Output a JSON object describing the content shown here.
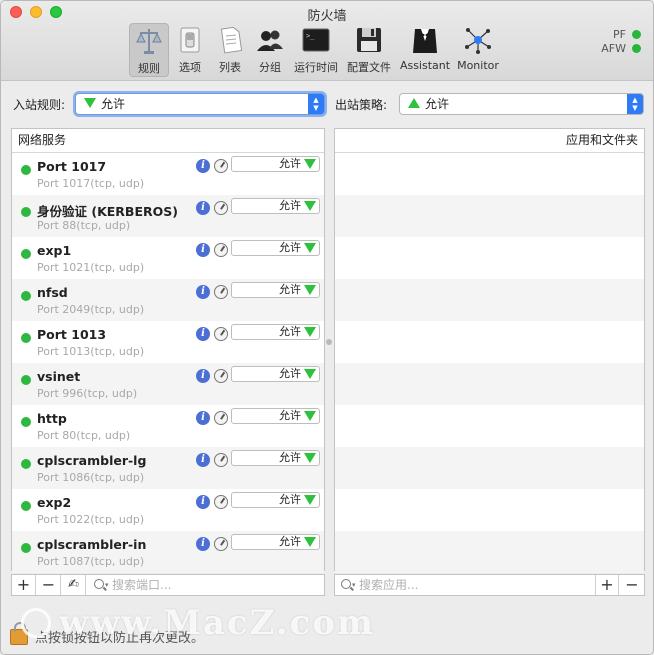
{
  "window": {
    "title": "防火墙"
  },
  "toolbar": {
    "items": [
      {
        "label": "规则",
        "icon": "scales-icon",
        "active": true
      },
      {
        "label": "选项",
        "icon": "toggle-icon"
      },
      {
        "label": "列表",
        "icon": "document-icon"
      },
      {
        "label": "分组",
        "icon": "users-icon"
      },
      {
        "label": "运行时间",
        "icon": "terminal-icon"
      },
      {
        "label": "配置文件",
        "icon": "floppy-icon"
      },
      {
        "label": "Assistant",
        "icon": "butler-icon"
      },
      {
        "label": "Monitor",
        "icon": "network-icon"
      }
    ]
  },
  "status": {
    "pf_label": "PF",
    "afw_label": "AFW",
    "color": "#28b63a"
  },
  "inbound": {
    "label": "入站规则:",
    "value": "允许"
  },
  "outbound": {
    "label": "出站策略:",
    "value": "允许"
  },
  "services": {
    "header": "网络服务",
    "rows": [
      {
        "name": "Port 1017",
        "port": "Port 1017(tcp, udp)",
        "policy": "允许"
      },
      {
        "name": "身份验证 (KERBEROS)",
        "port": "Port 88(tcp, udp)",
        "policy": "允许"
      },
      {
        "name": "exp1",
        "port": "Port 1021(tcp, udp)",
        "policy": "允许"
      },
      {
        "name": "nfsd",
        "port": "Port 2049(tcp, udp)",
        "policy": "允许"
      },
      {
        "name": "Port 1013",
        "port": "Port 1013(tcp, udp)",
        "policy": "允许"
      },
      {
        "name": "vsinet",
        "port": "Port 996(tcp, udp)",
        "policy": "允许"
      },
      {
        "name": "http",
        "port": "Port 80(tcp, udp)",
        "policy": "允许"
      },
      {
        "name": "cplscrambler-lg",
        "port": "Port 1086(tcp, udp)",
        "policy": "允许"
      },
      {
        "name": "exp2",
        "port": "Port 1022(tcp, udp)",
        "policy": "允许"
      },
      {
        "name": "cplscrambler-in",
        "port": "Port 1087(tcp, udp)",
        "policy": "允许"
      }
    ],
    "search_placeholder": "搜索端口..."
  },
  "apps": {
    "header": "应用和文件夹",
    "search_placeholder": "搜索应用..."
  },
  "buttons": {
    "add": "+",
    "remove": "−"
  },
  "footer": {
    "text": "点按锁按钮以防止再次更改。"
  },
  "watermark": {
    "text": "www.MacZ.com"
  },
  "colors": {
    "allow_green": "#2ec13e",
    "accent_blue": "#2f7bf5"
  }
}
